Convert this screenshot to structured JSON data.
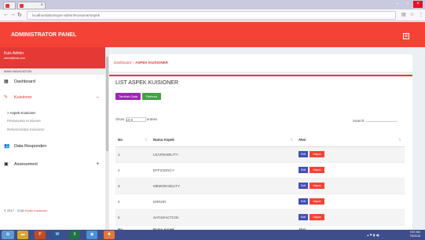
{
  "browser": {
    "url": "localhost/abu/super-admin/Kuisioner/aspek",
    "tab1": "",
    "tab2": ""
  },
  "header": {
    "brand": "ADMINISTRATOR PANEL"
  },
  "sidebar": {
    "user_name": "Kuis Admin",
    "user_email": "admin@kuis.com",
    "main_nav": "MAIN NAVIGATION",
    "items": [
      {
        "label": "Dashboard"
      },
      {
        "label": "Kuisioner"
      },
      {
        "label": "Data Responden"
      },
      {
        "label": "Assessment"
      }
    ],
    "sub": [
      "> Aspek Kuisioner",
      "Pertanyaan Kuisioner",
      "Rekomendasi Kuisioner"
    ],
    "copyright_prefix": "© 2017 - 2018 ",
    "copyright_brand": "Kuder Kuisioner."
  },
  "breadcrumb": {
    "home": "Dashboard",
    "sep": " > ",
    "current": "ASPEK KUISIONER"
  },
  "box": {
    "title": "LIST ASPEK KUISIONER",
    "add_label": "Tambah Data",
    "refresh_label": "Refresh",
    "show_label": "Show",
    "show_value": "10",
    "entries_label": "entries",
    "search_label": "Search:"
  },
  "table": {
    "headers": [
      "No",
      "Nama Aspek",
      "Aksi"
    ],
    "rows": [
      {
        "no": "1",
        "name": "LEARNABILITY"
      },
      {
        "no": "2",
        "name": "EFFICIENCY"
      },
      {
        "no": "3",
        "name": "MEMORABILITY"
      },
      {
        "no": "4",
        "name": "ERROR"
      },
      {
        "no": "5",
        "name": "SATISFACTION"
      }
    ],
    "edit_label": "Edit",
    "delete_label": "Hapus"
  },
  "taskbar": {
    "time": "9:57 AM",
    "date": "7/6/2018"
  }
}
